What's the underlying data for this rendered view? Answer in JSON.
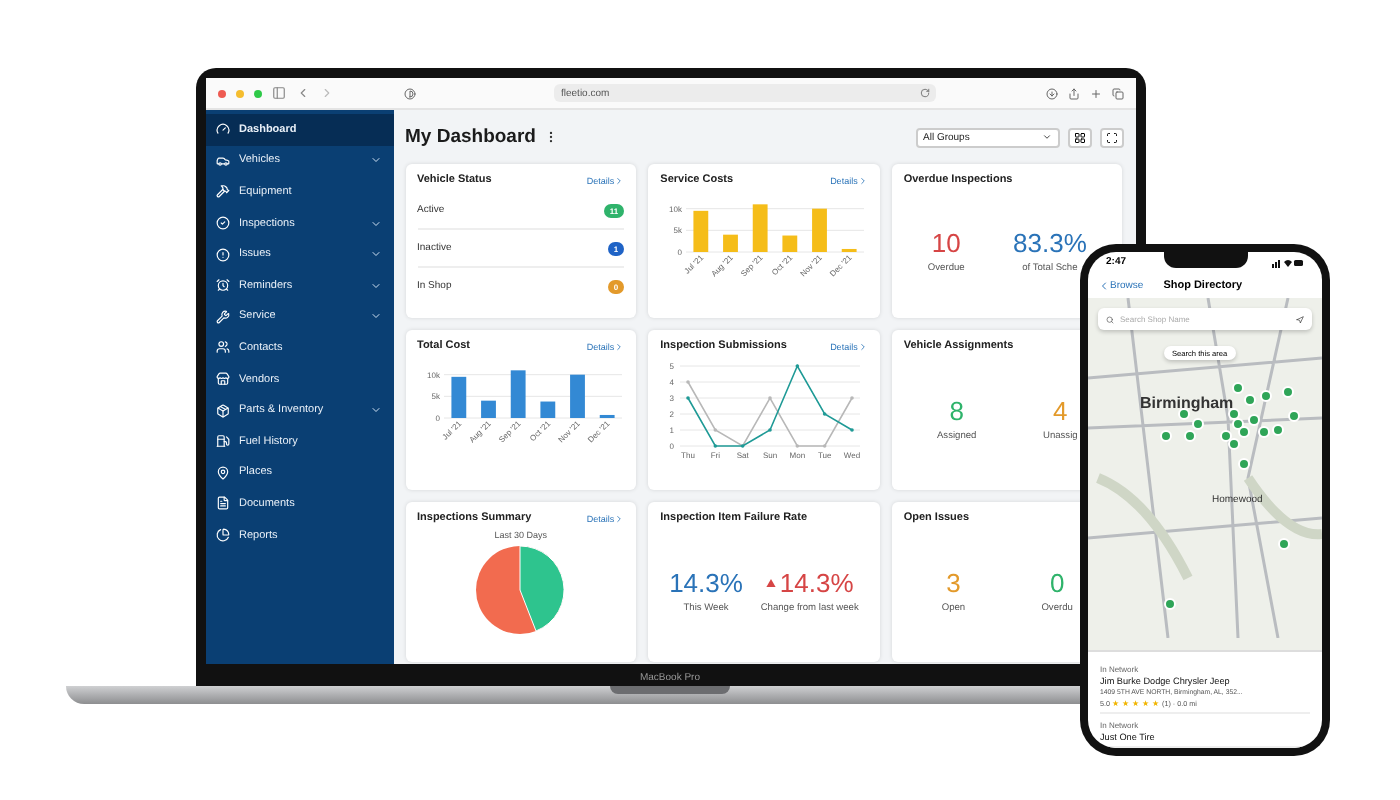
{
  "browser": {
    "url": "fleetio.com"
  },
  "sidebar": {
    "items": [
      {
        "label": "Dashboard",
        "selected": true,
        "has_submenu": false
      },
      {
        "label": "Vehicles",
        "selected": false,
        "has_submenu": true
      },
      {
        "label": "Equipment",
        "selected": false,
        "has_submenu": false
      },
      {
        "label": "Inspections",
        "selected": false,
        "has_submenu": true
      },
      {
        "label": "Issues",
        "selected": false,
        "has_submenu": true
      },
      {
        "label": "Reminders",
        "selected": false,
        "has_submenu": true
      },
      {
        "label": "Service",
        "selected": false,
        "has_submenu": true
      },
      {
        "label": "Contacts",
        "selected": false,
        "has_submenu": false
      },
      {
        "label": "Vendors",
        "selected": false,
        "has_submenu": false
      },
      {
        "label": "Parts & Inventory",
        "selected": false,
        "has_submenu": true
      },
      {
        "label": "Fuel History",
        "selected": false,
        "has_submenu": false
      },
      {
        "label": "Places",
        "selected": false,
        "has_submenu": false
      },
      {
        "label": "Documents",
        "selected": false,
        "has_submenu": false
      },
      {
        "label": "Reports",
        "selected": false,
        "has_submenu": false
      }
    ]
  },
  "header": {
    "title": "My Dashboard",
    "group_select": "All Groups"
  },
  "cards": [
    {
      "kind": "status_list",
      "title": "Vehicle Status",
      "details": "Details",
      "rows": [
        {
          "label": "Active",
          "count": "11",
          "color": "#2fb36b"
        },
        {
          "label": "Inactive",
          "count": "1",
          "color": "#1f63c6"
        },
        {
          "label": "In Shop",
          "count": "0",
          "color": "#e39a2b"
        }
      ]
    },
    {
      "kind": "chart",
      "title": "Service Costs",
      "details": "Details",
      "chart_data": {
        "type": "bar",
        "categories": [
          "Jul '21",
          "Aug '21",
          "Sep '21",
          "Oct '21",
          "Nov '21",
          "Dec '21"
        ],
        "series": [
          {
            "color": "#f5bd19",
            "values": [
              9500,
              4000,
              11000,
              3800,
              10000,
              700
            ]
          }
        ],
        "grid": true,
        "ylim": [
          0,
          12000
        ],
        "yticks": [
          {
            "value": 0,
            "label": "0"
          },
          {
            "value": 5000,
            "label": "5k"
          },
          {
            "value": 10000,
            "label": "10k"
          }
        ]
      }
    },
    {
      "kind": "stats",
      "title": "Overdue Inspections",
      "stats": [
        {
          "value": "10",
          "label": "Overdue",
          "color": "#d64545",
          "trend_up": false
        },
        {
          "value": "83.3%",
          "label": "of Total Sche",
          "color": "#2a73b8",
          "trend_up": false
        }
      ]
    },
    {
      "kind": "chart",
      "title": "Total Cost",
      "details": "Details",
      "chart_data": {
        "type": "bar",
        "categories": [
          "Jul '21",
          "Aug '21",
          "Sep '21",
          "Oct '21",
          "Nov '21",
          "Dec '21"
        ],
        "series": [
          {
            "color": "#3389d4",
            "values": [
              9500,
              4000,
              11000,
              3800,
              10000,
              700
            ]
          }
        ],
        "grid": true,
        "ylim": [
          0,
          12000
        ],
        "yticks": [
          {
            "value": 0,
            "label": "0"
          },
          {
            "value": 5000,
            "label": "5k"
          },
          {
            "value": 10000,
            "label": "10k"
          }
        ]
      }
    },
    {
      "kind": "chart",
      "title": "Inspection Submissions",
      "details": "Details",
      "chart_data": {
        "type": "line",
        "categories": [
          "Thu",
          "Fri",
          "Sat",
          "Sun",
          "Mon",
          "Tue",
          "Wed"
        ],
        "series": [
          {
            "color": "#b8b8b8",
            "values": [
              4,
              1,
              0,
              3,
              0,
              0,
              3
            ]
          },
          {
            "color": "#1f9a96",
            "values": [
              3,
              0,
              0,
              1,
              5,
              2,
              1
            ]
          }
        ],
        "grid": true,
        "ylim": [
          0,
          5
        ],
        "yticks": [
          0,
          1,
          2,
          3,
          4,
          5
        ]
      }
    },
    {
      "kind": "stats",
      "title": "Vehicle Assignments",
      "stats": [
        {
          "value": "8",
          "label": "Assigned",
          "color": "#2fb36b",
          "trend_up": false
        },
        {
          "value": "4",
          "label": "Unassig",
          "color": "#e39a2b",
          "trend_up": false
        }
      ]
    },
    {
      "kind": "pie",
      "title": "Inspections Summary",
      "details": "Details",
      "subtitle": "Last 30 Days"
    },
    {
      "kind": "stats",
      "title": "Inspection Item Failure Rate",
      "stats": [
        {
          "value": "14.3%",
          "label": "This Week",
          "color": "#2a73b8",
          "trend_up": false
        },
        {
          "value": "14.3%",
          "label": "Change from last week",
          "color": "#d64545",
          "trend_up": true
        }
      ]
    },
    {
      "kind": "stats",
      "title": "Open Issues",
      "stats": [
        {
          "value": "3",
          "label": "Open",
          "color": "#e39a2b",
          "trend_up": false
        },
        {
          "value": "0",
          "label": "Overdu",
          "color": "#2fb36b",
          "trend_up": false
        }
      ]
    }
  ],
  "laptop": {
    "label": "MacBook Pro"
  },
  "phone": {
    "time": "2:47",
    "back": "Browse",
    "title": "Shop Directory",
    "search": {
      "placeholder": "Search Shop Name"
    },
    "map": {
      "button": "Search this area",
      "labels": [
        {
          "text": "Birmingham",
          "kind": "city"
        },
        {
          "text": "Homewood",
          "kind": "town"
        }
      ]
    },
    "results": [
      {
        "badge": "In Network",
        "name": "Jim Burke Dodge Chrysler Jeep",
        "address": "1409 5TH AVE NORTH, Birmingham, AL, 352...",
        "rating": "5.0",
        "stars": 5,
        "meta": "(1) · 0.0 mi"
      },
      {
        "badge": "In Network",
        "name": "Just One Tire"
      }
    ]
  }
}
